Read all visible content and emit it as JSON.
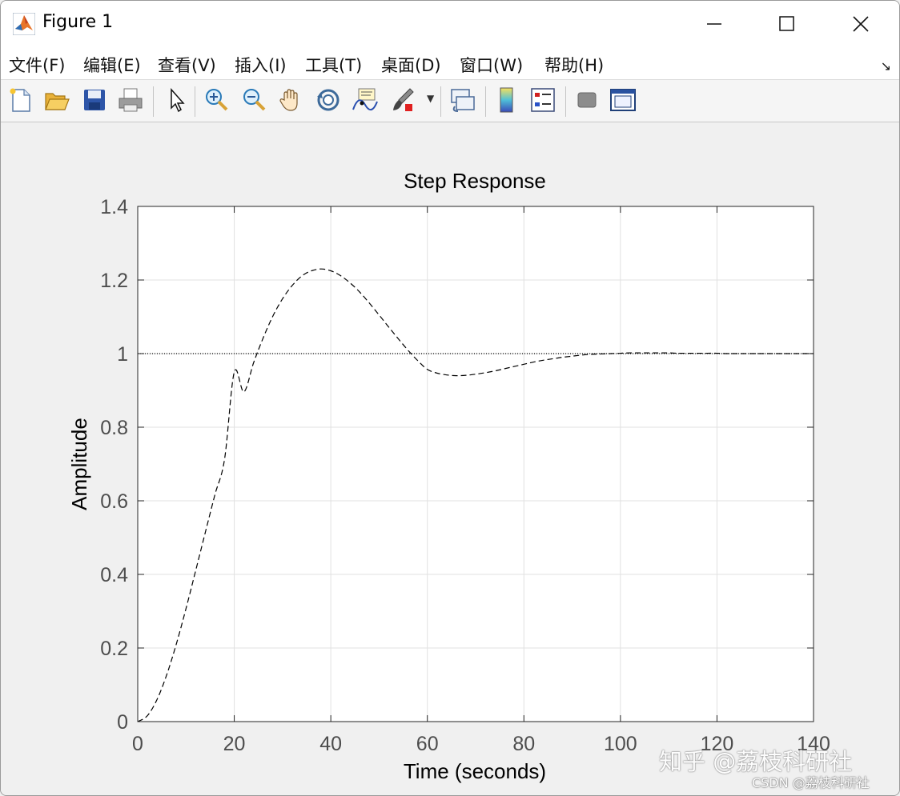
{
  "window": {
    "title": "Figure 1"
  },
  "menu": [
    {
      "label": "文件(F)"
    },
    {
      "label": "编辑(E)"
    },
    {
      "label": "查看(V)"
    },
    {
      "label": "插入(I)"
    },
    {
      "label": "工具(T)"
    },
    {
      "label": "桌面(D)"
    },
    {
      "label": "窗口(W)"
    },
    {
      "label": "帮助(H)"
    }
  ],
  "toolbar": {
    "icons": [
      "new-figure-icon",
      "open-file-icon",
      "save-icon",
      "print-icon",
      "edit-plot-arrow-icon",
      "zoom-in-icon",
      "zoom-out-icon",
      "pan-hand-icon",
      "rotate-3d-icon",
      "data-cursor-icon",
      "brush-icon",
      "link-plot-icon",
      "colorbar-icon",
      "legend-icon",
      "hide-plot-tools-icon",
      "show-plot-tools-icon"
    ]
  },
  "watermark": {
    "line1": "知乎 @荔枝科研社",
    "line2": "CSDN @荔枝科研社"
  },
  "chart_data": {
    "type": "line",
    "title": "Step Response",
    "xlabel": "Time (seconds)",
    "ylabel": "Amplitude",
    "xlim": [
      0,
      140
    ],
    "ylim": [
      0,
      1.4
    ],
    "xticks": [
      "0",
      "20",
      "40",
      "60",
      "80",
      "100",
      "120",
      "140"
    ],
    "yticks": [
      "0",
      "0.2",
      "0.4",
      "0.6",
      "0.8",
      "1",
      "1.2",
      "1.4"
    ],
    "grid": true,
    "series": [
      {
        "style": "dashed",
        "x": [
          0,
          2,
          4,
          6,
          8,
          10,
          12,
          14,
          16,
          18,
          20,
          22,
          24,
          26,
          28,
          30,
          32,
          34,
          36,
          38,
          40,
          42,
          44,
          46,
          48,
          50,
          52,
          54,
          56,
          58,
          60,
          62,
          64,
          66,
          68,
          70,
          72,
          74,
          76,
          78,
          80,
          82,
          84,
          86,
          88,
          90,
          92,
          94,
          96,
          98,
          100,
          102,
          104,
          106,
          108,
          110,
          112,
          114,
          116,
          118,
          120,
          122,
          124,
          126,
          128,
          130,
          132,
          134,
          136,
          138,
          140
        ],
        "y": [
          0,
          0.016,
          0.06,
          0.127,
          0.211,
          0.307,
          0.41,
          0.514,
          0.617,
          0.714,
          0.95,
          0.896,
          0.975,
          1.043,
          1.102,
          1.149,
          1.185,
          1.211,
          1.225,
          1.23,
          1.225,
          1.212,
          1.192,
          1.167,
          1.137,
          1.105,
          1.072,
          1.04,
          1.009,
          0.981,
          0.957,
          0.947,
          0.942,
          0.94,
          0.941,
          0.944,
          0.948,
          0.953,
          0.959,
          0.965,
          0.971,
          0.977,
          0.982,
          0.986,
          0.99,
          0.993,
          0.996,
          0.998,
          0.999,
          1.0,
          1.001,
          1.002,
          1.002,
          1.002,
          1.002,
          1.002,
          1.001,
          1.001,
          1.001,
          1.001,
          1.001,
          1.0,
          1.0,
          1.0,
          1.0,
          1.0,
          1.0,
          1.0,
          1.0,
          1.0,
          1.0
        ]
      },
      {
        "style": "dotted",
        "x": [
          0,
          140
        ],
        "y": [
          1,
          1
        ]
      }
    ]
  }
}
